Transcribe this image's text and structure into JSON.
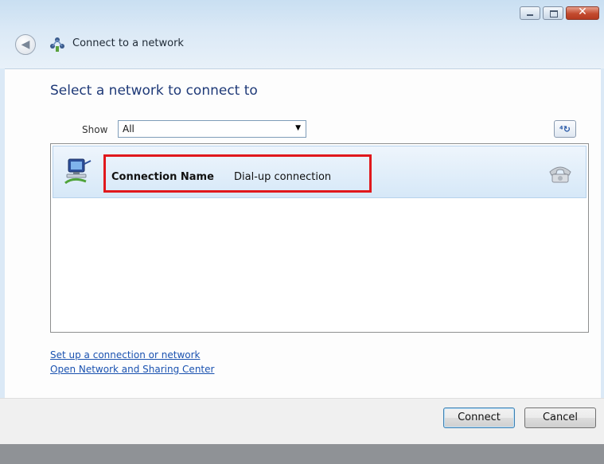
{
  "window": {
    "title": "Connect to a network",
    "controls": {
      "minimize": "minimize-icon",
      "maximize": "maximize-icon",
      "close": "close-icon"
    }
  },
  "main": {
    "heading": "Select a network to connect to",
    "show_label": "Show",
    "filter": {
      "selected": "All"
    }
  },
  "networks": [
    {
      "name": "Connection Name",
      "type": "Dial-up connection",
      "icon": "dialup-network-icon",
      "status_icon": "telephone-icon"
    }
  ],
  "links": {
    "setup": "Set up a connection or network",
    "sharing_center": "Open Network and Sharing Center"
  },
  "buttons": {
    "connect": "Connect",
    "cancel": "Cancel"
  },
  "colors": {
    "highlight": "#e0181c",
    "heading": "#1f3a78",
    "link": "#1a52b0"
  }
}
